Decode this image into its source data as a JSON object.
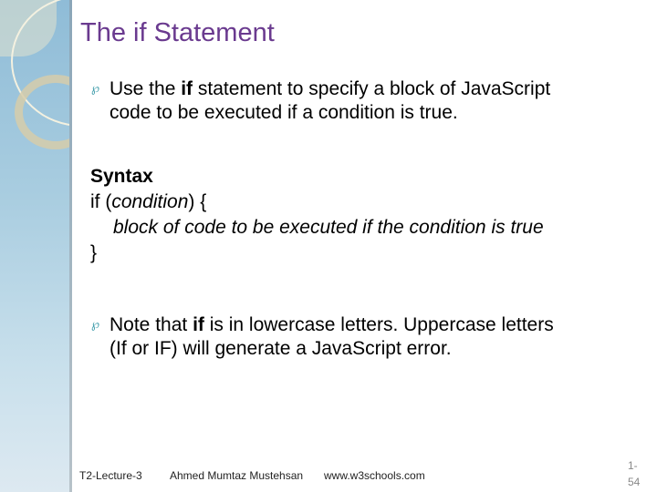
{
  "slide": {
    "title": "The if Statement",
    "bullet_icon": "curl-bullet-icon",
    "bullets": [
      {
        "pre": "Use the ",
        "bold": "if",
        "post_line1": " statement to specify a block of JavaScript",
        "line2": "code to be executed if a condition is true."
      },
      {
        "pre": "Note that ",
        "bold": "if",
        "post_line1": " is in lowercase letters. Uppercase letters",
        "line2": "(If or IF) will generate a JavaScript error."
      }
    ],
    "syntax": {
      "heading": "Syntax",
      "line1_pre": "if (",
      "line1_italic": "condition",
      "line1_post": ") {",
      "line2": "block of code to be executed if the condition is true",
      "line3": "}"
    }
  },
  "footer": {
    "lecture": "T2-Lecture-3",
    "author": "Ahmed Mumtaz Mustehsan",
    "source": "www.w3schools.com",
    "page_line1": "1-",
    "page_line2": "54"
  },
  "colors": {
    "title": "#6a3a8f",
    "bullet": "#3a9aa8",
    "sidebar": "#a9cde0"
  }
}
